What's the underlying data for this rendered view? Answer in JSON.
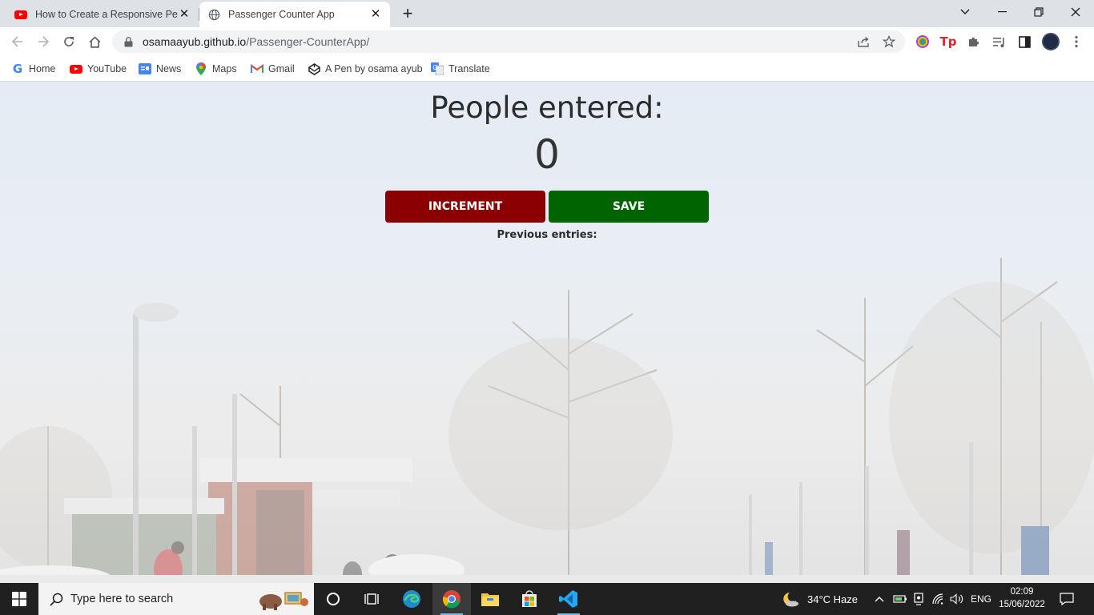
{
  "browser": {
    "tabs": [
      {
        "title": "How to Create a Responsive Pers",
        "active": false
      },
      {
        "title": "Passenger Counter App",
        "active": true
      }
    ],
    "url_host": "osamaayub.github.io",
    "url_path": "/Passenger-CounterApp/",
    "bookmarks": [
      "Home",
      "YouTube",
      "News",
      "Maps",
      "Gmail",
      "A Pen by osama ayub",
      "Translate"
    ]
  },
  "page": {
    "heading": "People entered:",
    "count": "0",
    "increment_label": "INCREMENT",
    "save_label": "SAVE",
    "previous_entries_label": "Previous entries:",
    "colors": {
      "increment": "#8b0000",
      "save": "#006400"
    }
  },
  "taskbar": {
    "search_placeholder": "Type here to search",
    "weather": "34°C  Haze",
    "language": "ENG",
    "time": "02:09",
    "date": "15/06/2022"
  }
}
